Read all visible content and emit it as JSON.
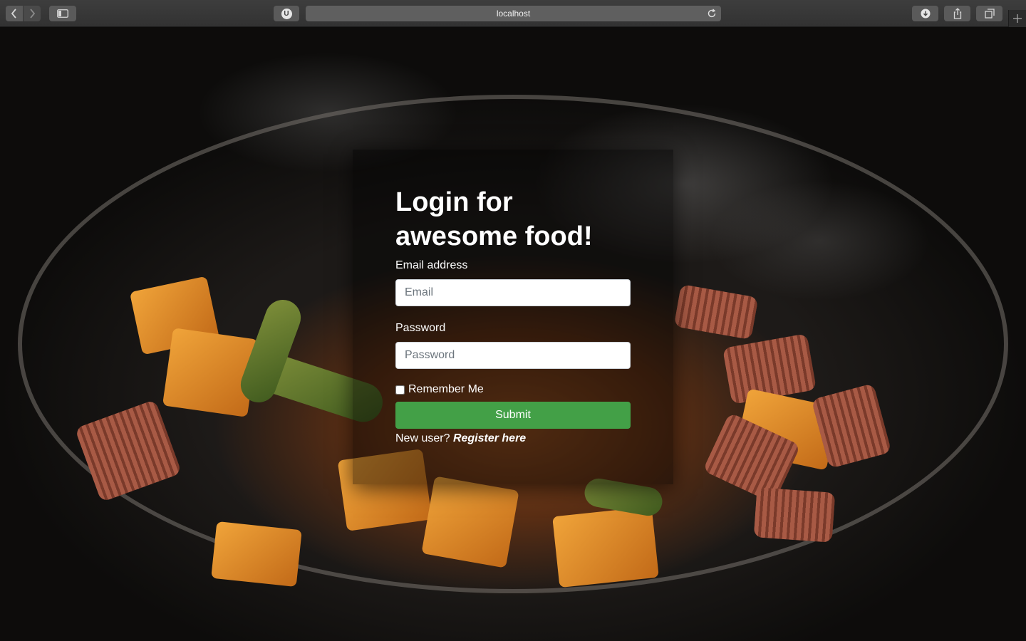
{
  "browser": {
    "url": "localhost",
    "extension_badge": "U",
    "icons": {
      "back": "chevron-left-icon",
      "forward": "chevron-right-icon",
      "sidebar": "sidebar-icon",
      "reload": "reload-icon",
      "download": "download-icon",
      "share": "share-icon",
      "tabs": "tabs-icon",
      "new_tab": "plus-icon"
    }
  },
  "login": {
    "title_line1": "Login for",
    "title_line2": "awesome food!",
    "email_label": "Email address",
    "email_placeholder": "Email",
    "password_label": "Password",
    "password_placeholder": "Password",
    "remember_label": "Remember Me",
    "submit_label": "Submit",
    "new_user_text": "New user?",
    "register_link": "Register here"
  },
  "colors": {
    "submit_bg": "#43a047",
    "card_overlay": "rgba(0,0,0,0.42)"
  }
}
